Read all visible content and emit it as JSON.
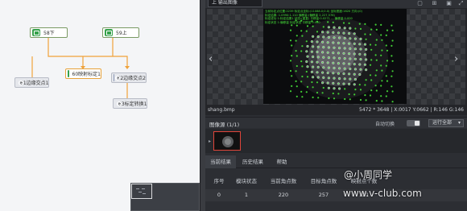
{
  "flow": {
    "nodes": [
      {
        "id": "n1",
        "label": "58下",
        "kind": "green"
      },
      {
        "id": "n2",
        "label": "59上",
        "kind": "green"
      },
      {
        "id": "n3",
        "label": "60映射标定1",
        "kind": "selected"
      },
      {
        "id": "n4",
        "label": "61边缘交点1",
        "kind": "gray"
      },
      {
        "id": "n5",
        "label": "62边缘交点2",
        "kind": "gray"
      },
      {
        "id": "n6",
        "label": "63标定转换1",
        "kind": "gray"
      }
    ]
  },
  "image_panel": {
    "source_select": "上 输出图像",
    "overlay_lines": [
      "当前标定点位置:2239 标定点坐标:(11088.0;0.0) 坐标宽度:1620 方向:(0)",
      "标定结果: 1.0990:1.110 偏移量:(偏移量 2,227,576)",
      "标定成功 1:标定结果1 状态:(重复) 平移量:0.0271 ... 偏移量 0.000",
      "标定状态 1:偏移量 标定状态 平移量 0.000"
    ],
    "file_name": "shang.bmp",
    "meta": "5472 * 3648 | X:0017 Y:0662 | R:146 G:146"
  },
  "image_source": {
    "title": "图像源 (1/1)",
    "auto_switch_label": "自动切换",
    "run_all_label": "运行全部"
  },
  "tabs": [
    {
      "label": "当前结果",
      "active": true
    },
    {
      "label": "历史结果",
      "active": false
    },
    {
      "label": "帮助",
      "active": false
    }
  ],
  "results_table": {
    "headers": [
      "序号",
      "模块状态",
      "当前角点数",
      "目标角点数",
      "映射点个数"
    ],
    "rows": [
      [
        "0",
        "1",
        "220",
        "257",
        "121"
      ]
    ]
  },
  "watermark": {
    "line1": "@小周同学",
    "line2": "www.v-club.com"
  },
  "colors": {
    "accent_green": "#47e03a",
    "selected_border": "#e8a23b",
    "connector": "#f0a23a"
  }
}
